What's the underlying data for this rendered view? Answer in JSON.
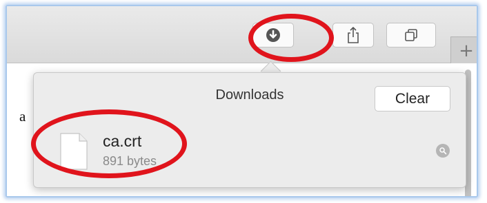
{
  "toolbar": {
    "buttons": [
      {
        "name": "download-button",
        "icon": "download-icon"
      },
      {
        "name": "share-button",
        "icon": "share-icon"
      },
      {
        "name": "tabs-overview-button",
        "icon": "tabs-overview-icon"
      }
    ],
    "new_tab_label": "+"
  },
  "page": {
    "visible_text": "a"
  },
  "downloads": {
    "title": "Downloads",
    "clear_label": "Clear",
    "items": [
      {
        "name": "ca.crt",
        "size": "891 bytes",
        "icon": "document-icon",
        "action_icon": "magnifier-icon"
      }
    ]
  },
  "annotations": {
    "highlight_color": "#e0141c"
  }
}
